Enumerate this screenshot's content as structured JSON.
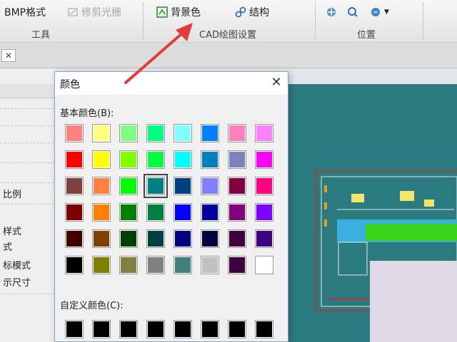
{
  "ribbon": {
    "bmp_format_label": "BMP格式",
    "trim_raster_label": "修剪光栅",
    "tools_caption": "工具",
    "background_color_label": "背景色",
    "structure_label": "结构",
    "cad_settings_caption": "CAD绘图设置",
    "position_caption": "位置"
  },
  "tab": {
    "close_glyph": "✕"
  },
  "left_panel": {
    "items": [
      "比例",
      "样式",
      "式",
      "标模式",
      "示尺寸"
    ]
  },
  "dialog": {
    "title": "颜色",
    "close_glyph": "✕",
    "basic_colors_label": "基本颜色(B):",
    "custom_colors_label": "自定义颜色(C):",
    "basic_colors": [
      "#ff8080",
      "#ffff80",
      "#80ff80",
      "#00ff80",
      "#80ffff",
      "#0080ff",
      "#ff80c0",
      "#ff80ff",
      "#ff0000",
      "#ffff00",
      "#80ff00",
      "#00ff40",
      "#00ffff",
      "#0080c0",
      "#8080c0",
      "#ff00ff",
      "#804040",
      "#ff8040",
      "#00ff00",
      "#008080",
      "#004080",
      "#8080ff",
      "#800040",
      "#ff0080",
      "#800000",
      "#ff8000",
      "#008000",
      "#008040",
      "#0000ff",
      "#0000a0",
      "#800080",
      "#8000ff",
      "#400000",
      "#804000",
      "#004000",
      "#004040",
      "#000080",
      "#000040",
      "#400040",
      "#400080",
      "#000000",
      "#808000",
      "#808040",
      "#808080",
      "#408080",
      "#c0c0c0",
      "#400040",
      "#ffffff"
    ],
    "selected_index": 19,
    "custom_colors": [
      "#000000",
      "#000000",
      "#000000",
      "#000000",
      "#000000",
      "#000000",
      "#000000",
      "#000000"
    ]
  }
}
